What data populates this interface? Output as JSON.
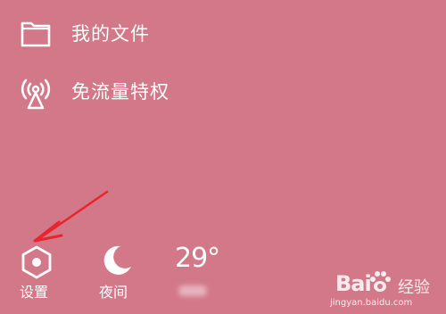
{
  "menu": {
    "items": [
      {
        "label": "我的文件",
        "icon": "folder-icon"
      },
      {
        "label": "免流量特权",
        "icon": "broadcast-antenna-icon"
      }
    ]
  },
  "bottom_bar": {
    "settings": {
      "label": "设置",
      "icon": "hexagon-settings-icon"
    },
    "night_mode": {
      "label": "夜间",
      "icon": "crescent-moon-icon"
    },
    "weather": {
      "temperature": "29°"
    }
  },
  "annotation": {
    "icon": "red-arrow-pointer",
    "color": "#e8252f"
  },
  "watermark": {
    "brand": "Bai",
    "brand_suffix": "经验",
    "url": "jingyan.baidu.com"
  },
  "colors": {
    "background": "#d37888",
    "foreground": "#ffffff"
  }
}
